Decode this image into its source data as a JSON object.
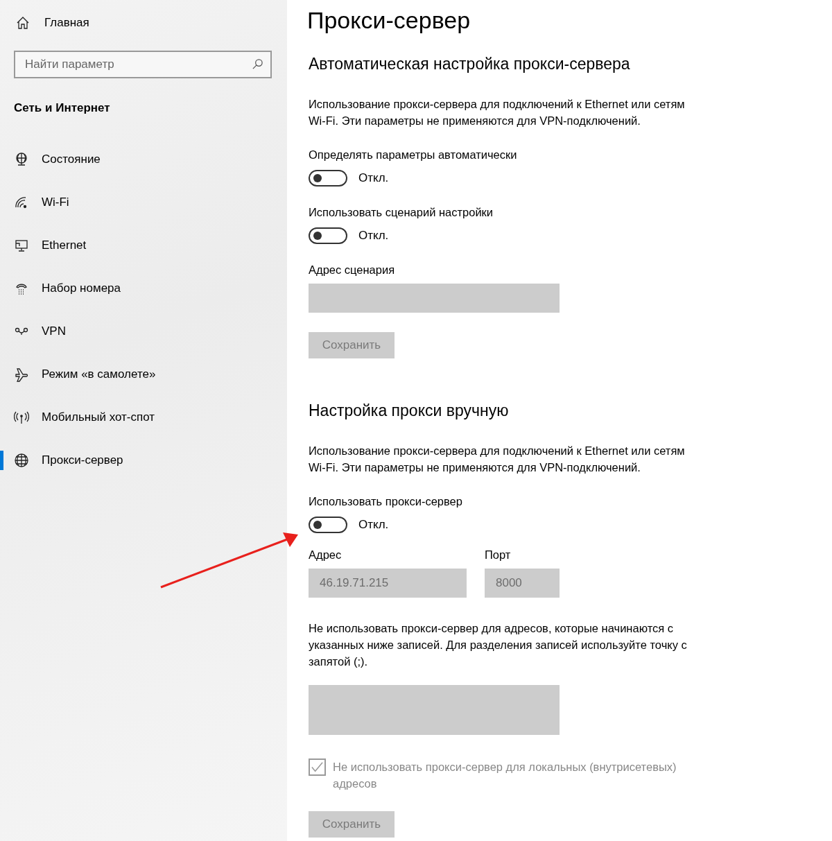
{
  "sidebar": {
    "home": {
      "label": "Главная"
    },
    "search": {
      "placeholder": "Найти параметр"
    },
    "section_title": "Сеть и Интернет",
    "items": [
      {
        "label": "Состояние",
        "selected": false
      },
      {
        "label": "Wi-Fi",
        "selected": false
      },
      {
        "label": "Ethernet",
        "selected": false
      },
      {
        "label": "Набор номера",
        "selected": false
      },
      {
        "label": "VPN",
        "selected": false
      },
      {
        "label": "Режим «в самолете»",
        "selected": false
      },
      {
        "label": "Мобильный хот-спот",
        "selected": false
      },
      {
        "label": "Прокси-сервер",
        "selected": true
      }
    ]
  },
  "page_title": "Прокси-сервер",
  "sections": [
    {
      "heading": "Автоматическая настройка прокси-сервера",
      "controls": [
        {
          "kind": "paragraph",
          "text": "Использование прокси-сервера для подключений к Ethernet или сетям Wi-Fi. Эти параметры не применяются для VPN-подключений."
        },
        {
          "kind": "toggle",
          "label": "Определять параметры автоматически",
          "on": false,
          "state_text": "Откл."
        },
        {
          "kind": "toggle",
          "label": "Использовать сценарий настройки",
          "on": false,
          "state_text": "Откл."
        },
        {
          "kind": "field",
          "label": "Адрес сценария",
          "disabled": true
        },
        {
          "kind": "button",
          "label": "Сохранить",
          "disabled": true
        }
      ]
    },
    {
      "heading": "Настройка прокси вручную",
      "controls": [
        {
          "kind": "paragraph",
          "text": "Использование прокси-сервера для подключений к Ethernet или сетям Wi-Fi. Эти параметры не применяются для VPN-подключений."
        },
        {
          "kind": "toggle",
          "label": "Использовать прокси-сервер",
          "on": false,
          "state_text": "Откл."
        },
        {
          "kind": "field_pair",
          "fields": [
            {
              "label": "Адрес",
              "value": "46.19.71.215",
              "disabled": true
            },
            {
              "label": "Порт",
              "value": "8000",
              "disabled": true
            }
          ]
        },
        {
          "kind": "paragraph",
          "text": "Не использовать прокси-сервер для адресов, которые начинаются с указанных ниже записей. Для разделения записей используйте точку с запятой (;)."
        },
        {
          "kind": "textarea",
          "disabled": true
        },
        {
          "kind": "checkbox",
          "label": "Не использовать прокси-сервер для локальных (внутрисетевых) адресов",
          "checked": true,
          "disabled": true
        },
        {
          "kind": "button",
          "label": "Сохранить",
          "disabled": true
        }
      ]
    }
  ]
}
